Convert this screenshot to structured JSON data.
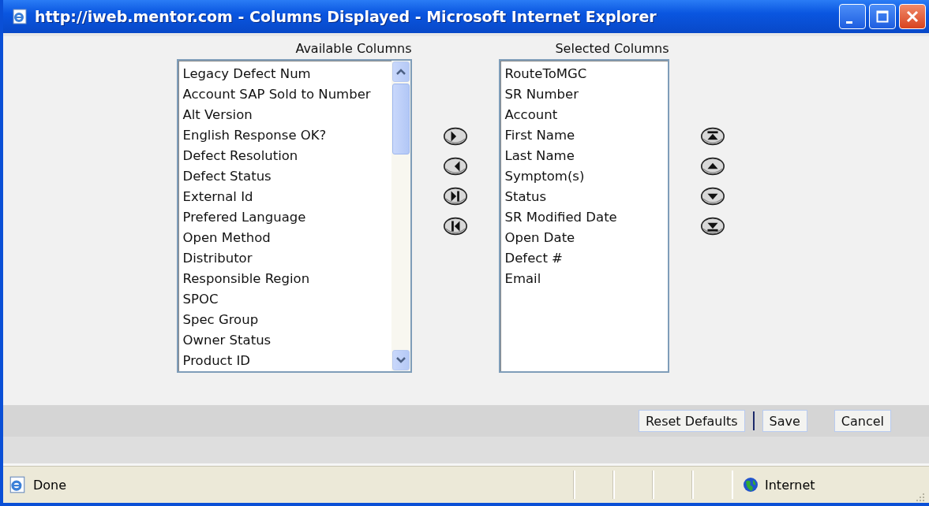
{
  "window": {
    "title": "http://iweb.mentor.com - Columns Displayed - Microsoft Internet Explorer"
  },
  "available": {
    "label": "Available Columns",
    "items": [
      "Legacy Defect Num",
      "Account SAP Sold to Number",
      "Alt Version",
      "English Response OK?",
      "Defect Resolution",
      "Defect Status",
      "External Id",
      "Prefered Language",
      "Open Method",
      "Distributor",
      "Responsible Region",
      "SPOC",
      "Spec Group",
      "Owner Status",
      "Product ID"
    ]
  },
  "move_buttons": [
    {
      "kind": "add"
    },
    {
      "kind": "remove"
    },
    {
      "kind": "add_all"
    },
    {
      "kind": "remove_all"
    }
  ],
  "selected": {
    "label": "Selected Columns",
    "items": [
      "RouteToMGC",
      "SR Number",
      "Account",
      "First Name",
      "Last Name",
      "Symptom(s)",
      "Status",
      "SR Modified Date",
      "Open Date",
      "Defect #",
      "Email"
    ]
  },
  "order_buttons": [
    {
      "kind": "top"
    },
    {
      "kind": "up"
    },
    {
      "kind": "down"
    },
    {
      "kind": "bottom"
    }
  ],
  "buttons": [
    "Reset Defaults",
    "Save",
    "Cancel"
  ],
  "status_bar": {
    "text": "Done",
    "zone": "Internet"
  }
}
